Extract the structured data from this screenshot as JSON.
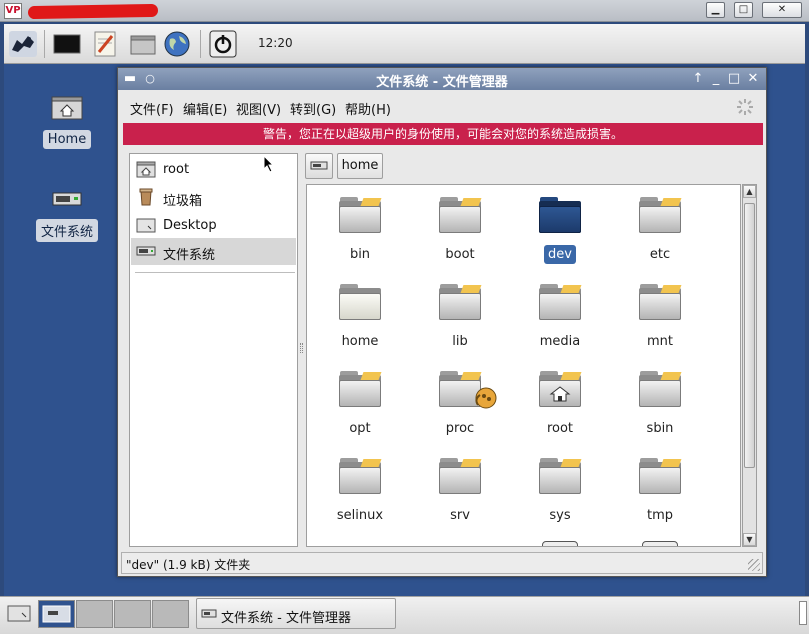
{
  "outer": {
    "logo_text": "VP",
    "ctrl_min": "▁",
    "ctrl_max": "□",
    "ctrl_close": "✕"
  },
  "top_panel": {
    "clock": "12:20"
  },
  "desktop": {
    "icons": [
      {
        "label": "Home"
      },
      {
        "label": "文件系统"
      }
    ]
  },
  "window": {
    "title": "文件系统 - 文件管理器",
    "menus": [
      "文件(F)",
      "编辑(E)",
      "视图(V)",
      "转到(G)",
      "帮助(H)"
    ],
    "warning": "警告，您正在以超级用户的身份使用，可能会对您的系统造成损害。",
    "sidebar": [
      {
        "label": "root"
      },
      {
        "label": "垃圾箱"
      },
      {
        "label": "Desktop"
      },
      {
        "label": "文件系统"
      }
    ],
    "location": {
      "path_button": "home"
    },
    "files": [
      {
        "name": "bin"
      },
      {
        "name": "boot"
      },
      {
        "name": "dev",
        "selected": true
      },
      {
        "name": "etc"
      },
      {
        "name": "home"
      },
      {
        "name": "lib"
      },
      {
        "name": "media"
      },
      {
        "name": "mnt"
      },
      {
        "name": "opt"
      },
      {
        "name": "proc"
      },
      {
        "name": "root"
      },
      {
        "name": "sbin"
      },
      {
        "name": "selinux"
      },
      {
        "name": "srv"
      },
      {
        "name": "sys"
      },
      {
        "name": "tmp"
      }
    ],
    "status": "\"dev\" (1.9 kB) 文件夹"
  },
  "taskbar": {
    "task_label": "文件系统 - 文件管理器"
  },
  "colors": {
    "warning_bg": "#c9214c",
    "selection": "#3a68a8",
    "desktop": "#2f528e"
  }
}
